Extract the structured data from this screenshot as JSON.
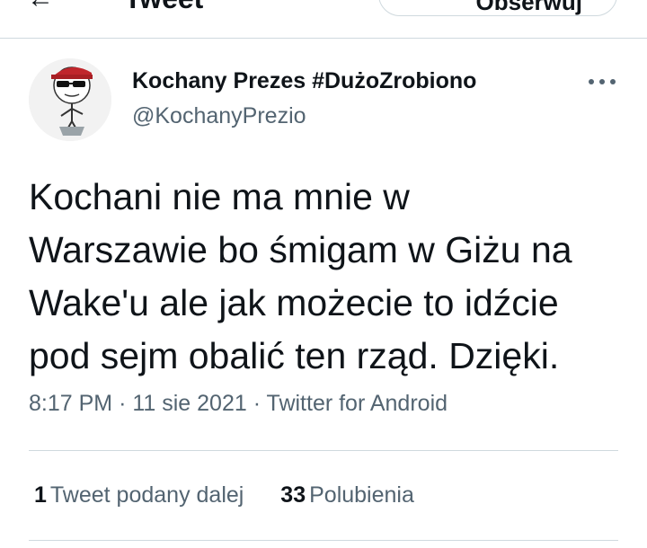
{
  "header": {
    "back_icon": "arrow-left-icon",
    "title": "Tweet",
    "follow_label": "Obserwuj"
  },
  "tweet": {
    "author": {
      "name": "Kochany Prezes #DużoZrobiono",
      "handle": "@KochanyPrezio",
      "avatar_icon": "cartoon-avatar"
    },
    "more_icon": "more-horizontal-icon",
    "text_lines": [
      "Kochani nie ma mnie w",
      "Warszawie bo śmigam w Giżu na",
      "Wake'u ale jak możecie to idźcie",
      "pod sejm obalić ten rząd. Dzięki."
    ],
    "meta": {
      "time": "8:17 PM",
      "date": "11 sie 2021",
      "source": "Twitter for Android"
    },
    "stats": {
      "retweets_count": "1",
      "retweets_label": "Tweet podany dalej",
      "likes_count": "33",
      "likes_label": "Polubienia"
    }
  },
  "colors": {
    "text_primary": "#0f1419",
    "text_secondary": "#536471",
    "divider": "#cfd9de",
    "avatar_cap": "#c0262c"
  }
}
